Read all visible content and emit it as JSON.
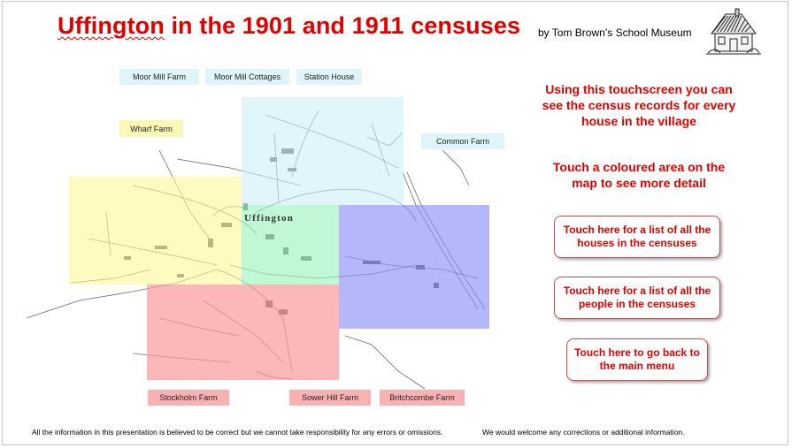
{
  "header": {
    "title_part1": "Uffington",
    "title_part2": " in the 1901 and 1911 censuses",
    "byline": "by Tom Brown’s School Museum"
  },
  "map": {
    "town_label": "Uffington",
    "region_labels": {
      "moor_mill_farm": "Moor Mill Farm",
      "moor_mill_cottages": "Moor Mill Cottages",
      "station_house": "Station House",
      "wharf_farm": "Wharf Farm",
      "common_farm": "Common Farm",
      "stockholm_farm": "Stockholm Farm",
      "sower_hill_farm": "Sower Hill Farm",
      "britchcombe_farm": "Britchcombe Farm"
    },
    "area_colors": {
      "north": "#cdf0f8",
      "west": "#fff79a",
      "center": "#9ef2bd",
      "east": "#8f8ff8",
      "south": "#fb9a9a"
    }
  },
  "instructions": {
    "intro": "Using this touchscreen you can see the census records for every house in the village",
    "touch_area": "Touch a coloured area on the map to see more detail"
  },
  "buttons": {
    "houses": "Touch here for a list of all the houses in the censuses",
    "people": "Touch here for a list of all the people in the censuses",
    "main_menu": "Touch here to go back to the main menu"
  },
  "footer": {
    "disclaimer": "All the information in this presentation is believed to be correct but we cannot take responsibility for any errors or omissions.",
    "corrections": "We would welcome any corrections or additional information."
  },
  "colors": {
    "accent_red": "#e00000",
    "button_border": "#d24c4c"
  }
}
